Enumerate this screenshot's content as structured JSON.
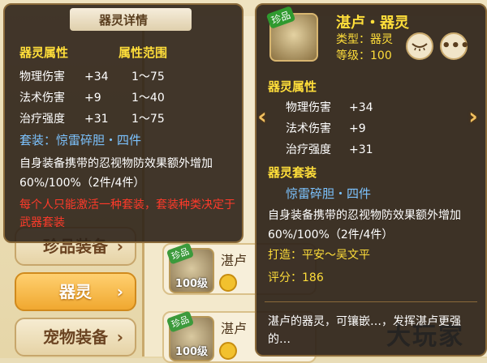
{
  "left_tooltip": {
    "title": "器灵详情",
    "col_attr": "器灵属性",
    "col_range": "属性范围",
    "rows": [
      {
        "name": "物理伤害",
        "value": "+34",
        "range": "1～75"
      },
      {
        "name": "法术伤害",
        "value": "+9",
        "range": "1～40"
      },
      {
        "name": "治疗强度",
        "value": "+31",
        "range": "1～75"
      }
    ],
    "set_label": "套装：惊雷碎胆・四件",
    "set_desc": "自身装备携带的忍视物防效果额外增加60%/100%（2件/4件）",
    "warning": "每个人只能激活一种套装，套装种类决定于武器套装"
  },
  "right_tooltip": {
    "tag": "珍品",
    "name": "湛卢・器灵",
    "type": "类型：器灵",
    "level": "等级：100",
    "eye_icon": "eye-closed-icon",
    "more_icon": "more-icon",
    "attr_section": "器灵属性",
    "attrs": [
      {
        "name": "物理伤害",
        "value": "+34"
      },
      {
        "name": "法术伤害",
        "value": "+9"
      },
      {
        "name": "治疗强度",
        "value": "+31"
      }
    ],
    "set_section": "器灵套装",
    "set_name": "惊雷碎胆・四件",
    "set_desc": "自身装备携带的忍视物防效果额外增加60%/100%（2件/4件）",
    "maker": "打造：平安～吴文平",
    "score": "评分：186",
    "footer": "湛卢的器灵，可镶嵌…，发挥湛卢更强的…"
  },
  "sidebar": {
    "items": [
      {
        "label": "珍品装备",
        "active": false
      },
      {
        "label": "器灵",
        "active": true
      },
      {
        "label": "宠物装备",
        "active": false
      }
    ]
  },
  "background": {
    "item1": {
      "tag": "珍品",
      "level": "100级",
      "name": "湛卢"
    },
    "item2": {
      "tag": "珍品",
      "level": "100级",
      "name": "湛卢"
    }
  },
  "nav": {
    "prev": "‹",
    "next": "›"
  },
  "watermark": "大玩家"
}
